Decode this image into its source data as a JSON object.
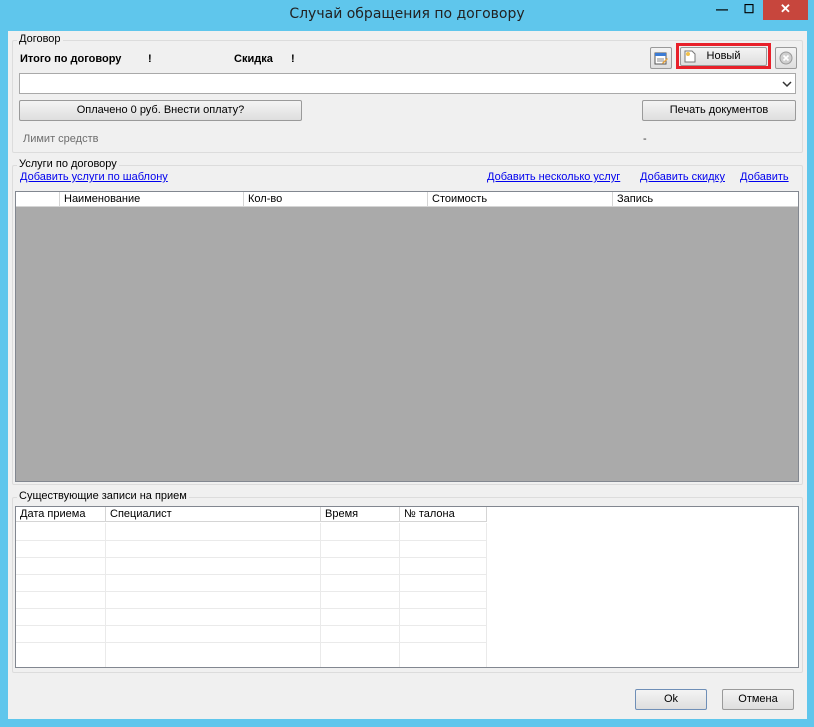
{
  "window": {
    "title": "Случай обращения по договору",
    "min_glyph": "—",
    "max_glyph": "☐",
    "close_glyph": "✕"
  },
  "contract": {
    "group_label": "Договор",
    "total_label": "Итого по договору",
    "total_value": "!",
    "discount_label": "Скидка",
    "discount_value": "!",
    "new_button": "Новый",
    "pay_button": "Оплачено 0 руб. Внести оплату?",
    "print_button": "Печать документов",
    "limit_label": "Лимит средств",
    "limit_value": "-",
    "combo_value": ""
  },
  "services": {
    "group_label": "Услуги по договору",
    "link_template": "Добавить услуги по шаблону",
    "link_multiple": "Добавить несколько услуг",
    "link_discount": "Добавить скидку",
    "link_add": "Добавить",
    "columns": [
      "Наименование",
      "Кол-во",
      "Стоимость",
      "Запись"
    ]
  },
  "appointments": {
    "group_label": "Существующие записи на прием",
    "columns": [
      "Дата приема",
      "Специалист",
      "Время",
      "№ талона"
    ]
  },
  "footer": {
    "ok": "Ok",
    "cancel": "Отмена"
  },
  "colors": {
    "title_bar": "#5fc6ec",
    "close_button": "#c7463d",
    "highlight": "#e8202a",
    "grid_empty": "#aaaaaa"
  },
  "icons": [
    "doc-edit-icon",
    "new-doc-icon",
    "remove-icon",
    "dropdown-arrow-icon"
  ]
}
